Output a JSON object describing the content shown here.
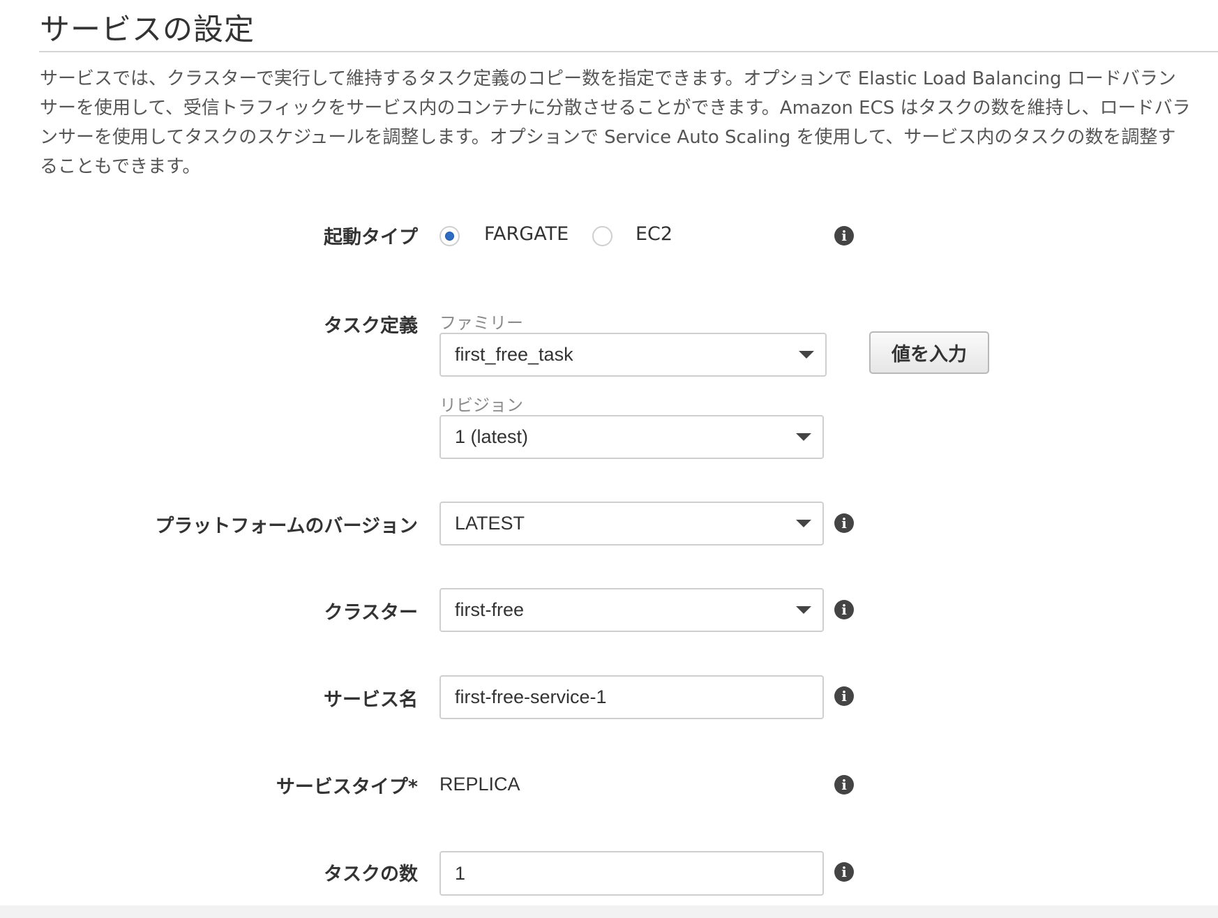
{
  "section": {
    "title": "サービスの設定",
    "description": "サービスでは、クラスターで実行して維持するタスク定義のコピー数を指定できます。オプションで Elastic Load Balancing ロードバランサーを使用して、受信トラフィックをサービス内のコンテナに分散させることができます。Amazon ECS はタスクの数を維持し、ロードバランサーを使用してタスクのスケジュールを調整します。オプションで Service Auto Scaling を使用して、サービス内のタスクの数を調整することもできます。"
  },
  "launch_type": {
    "label": "起動タイプ",
    "options": [
      {
        "label": "FARGATE",
        "selected": true
      },
      {
        "label": "EC2",
        "selected": false
      }
    ],
    "info_icon": "info-icon"
  },
  "task_definition": {
    "label": "タスク定義",
    "family_label": "ファミリー",
    "family_value": "first_free_task",
    "revision_label": "リビジョン",
    "revision_value": "1 (latest)",
    "enter_value_button": "値を入力"
  },
  "platform_version": {
    "label": "プラットフォームのバージョン",
    "value": "LATEST"
  },
  "cluster": {
    "label": "クラスター",
    "value": "first-free"
  },
  "service_name": {
    "label": "サービス名",
    "value": "first-free-service-1"
  },
  "service_type": {
    "label": "サービスタイプ*",
    "value": "REPLICA"
  },
  "task_count": {
    "label": "タスクの数",
    "value": "1"
  },
  "colors": {
    "radio_selected": "#2d6cc0",
    "border": "#cfcfcf",
    "text": "#333333"
  }
}
